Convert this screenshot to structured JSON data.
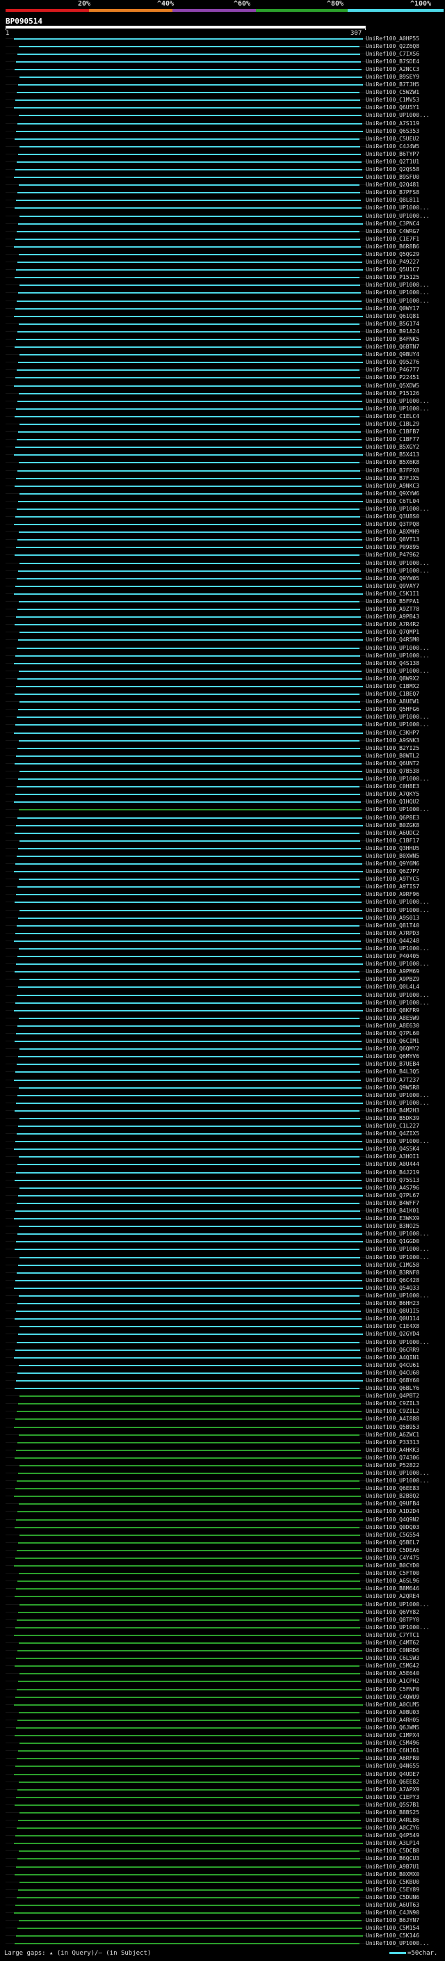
{
  "legend": {
    "percent_labels": [
      "20%",
      "^40%",
      "^60%",
      "^80%",
      "^100%"
    ],
    "colors": [
      "#d7191c",
      "#e67e22",
      "#8e44ad",
      "#2ca02c",
      "#4dd9e8"
    ]
  },
  "query": {
    "id": "BP090514",
    "start": "1",
    "end": "307"
  },
  "footer": {
    "text": "Large gaps: ▴ (in Query)/– (in Subject)",
    "scale_text": "=50char."
  },
  "hits": [
    {
      "id": "UniRef100_A0HP55",
      "c": "cyan"
    },
    {
      "id": "UniRef100_Q2Z6Q8",
      "c": "cyan"
    },
    {
      "id": "UniRef100_C7IXS6",
      "c": "cyan"
    },
    {
      "id": "UniRef100_B7SDE4",
      "c": "cyan"
    },
    {
      "id": "UniRef100_A2NCC3",
      "c": "cyan"
    },
    {
      "id": "UniRef100_B9SEY9",
      "c": "cyan"
    },
    {
      "id": "UniRef100_B7TJH5",
      "c": "cyan"
    },
    {
      "id": "UniRef100_C5WZW1",
      "c": "cyan"
    },
    {
      "id": "UniRef100_C1MV53",
      "c": "cyan"
    },
    {
      "id": "UniRef100_Q6U5Y1",
      "c": "cyan"
    },
    {
      "id": "UniRef100_UP1000...",
      "c": "cyan"
    },
    {
      "id": "UniRef100_A7S119",
      "c": "cyan"
    },
    {
      "id": "UniRef100_Q6S353",
      "c": "cyan"
    },
    {
      "id": "UniRef100_C5UEU2",
      "c": "cyan"
    },
    {
      "id": "UniRef100_C4J4W5",
      "c": "cyan"
    },
    {
      "id": "UniRef100_B6TYP7",
      "c": "cyan"
    },
    {
      "id": "UniRef100_Q2T1U1",
      "c": "cyan"
    },
    {
      "id": "UniRef100_Q2QS58",
      "c": "cyan"
    },
    {
      "id": "UniRef100_B9SFU0",
      "c": "cyan"
    },
    {
      "id": "UniRef100_Q2Q481",
      "c": "cyan"
    },
    {
      "id": "UniRef100_B7PFS8",
      "c": "cyan"
    },
    {
      "id": "UniRef100_Q8L811",
      "c": "cyan"
    },
    {
      "id": "UniRef100_UP1000...",
      "c": "cyan"
    },
    {
      "id": "UniRef100_UP1000...",
      "c": "cyan"
    },
    {
      "id": "UniRef100_C3PNC4",
      "c": "cyan"
    },
    {
      "id": "UniRef100_C4WRG7",
      "c": "cyan"
    },
    {
      "id": "UniRef100_C1E7F1",
      "c": "cyan"
    },
    {
      "id": "UniRef100_B6R8B6",
      "c": "cyan"
    },
    {
      "id": "UniRef100_Q5QG29",
      "c": "cyan"
    },
    {
      "id": "UniRef100_P49227",
      "c": "cyan"
    },
    {
      "id": "UniRef100_Q5U1C7",
      "c": "cyan"
    },
    {
      "id": "UniRef100_P15125",
      "c": "cyan"
    },
    {
      "id": "UniRef100_UP1000...",
      "c": "cyan"
    },
    {
      "id": "UniRef100_UP1000...",
      "c": "cyan"
    },
    {
      "id": "UniRef100_UP1000...",
      "c": "cyan"
    },
    {
      "id": "UniRef100_Q0WY17",
      "c": "cyan"
    },
    {
      "id": "UniRef100_Q61Q81",
      "c": "cyan"
    },
    {
      "id": "UniRef100_B5G174",
      "c": "cyan"
    },
    {
      "id": "UniRef100_B91A24",
      "c": "cyan"
    },
    {
      "id": "UniRef100_B4FNK5",
      "c": "cyan"
    },
    {
      "id": "UniRef100_Q6BTN7",
      "c": "cyan"
    },
    {
      "id": "UniRef100_Q9BUY4",
      "c": "cyan"
    },
    {
      "id": "UniRef100_Q95276",
      "c": "cyan"
    },
    {
      "id": "UniRef100_P46777",
      "c": "cyan"
    },
    {
      "id": "UniRef100_P22451",
      "c": "cyan"
    },
    {
      "id": "UniRef100_Q5XDW5",
      "c": "cyan"
    },
    {
      "id": "UniRef100_P15126",
      "c": "cyan"
    },
    {
      "id": "UniRef100_UP1000...",
      "c": "cyan"
    },
    {
      "id": "UniRef100_UP1000...",
      "c": "cyan"
    },
    {
      "id": "UniRef100_C1ELC4",
      "c": "cyan"
    },
    {
      "id": "UniRef100_C1BL29",
      "c": "cyan"
    },
    {
      "id": "UniRef100_C1BFB7",
      "c": "cyan"
    },
    {
      "id": "UniRef100_C1BF77",
      "c": "cyan"
    },
    {
      "id": "UniRef100_B5XGY2",
      "c": "cyan"
    },
    {
      "id": "UniRef100_B5X413",
      "c": "cyan"
    },
    {
      "id": "UniRef100_B5X6K8",
      "c": "cyan"
    },
    {
      "id": "UniRef100_B7FPX8",
      "c": "cyan"
    },
    {
      "id": "UniRef100_B7FJX5",
      "c": "cyan"
    },
    {
      "id": "UniRef100_A9NKC3",
      "c": "cyan"
    },
    {
      "id": "UniRef100_Q9XYW6",
      "c": "cyan"
    },
    {
      "id": "UniRef100_C6TL04",
      "c": "cyan"
    },
    {
      "id": "UniRef100_UP1000...",
      "c": "cyan"
    },
    {
      "id": "UniRef100_Q3U8S0",
      "c": "cyan"
    },
    {
      "id": "UniRef100_Q3TPQ8",
      "c": "cyan"
    },
    {
      "id": "UniRef100_A8XMH9",
      "c": "cyan"
    },
    {
      "id": "UniRef100_Q8VT13",
      "c": "cyan"
    },
    {
      "id": "UniRef100_P09895",
      "c": "cyan"
    },
    {
      "id": "UniRef100_P47962",
      "c": "cyan"
    },
    {
      "id": "UniRef100_UP1000...",
      "c": "cyan"
    },
    {
      "id": "UniRef100_UP1000...",
      "c": "cyan"
    },
    {
      "id": "UniRef100_Q9YW05",
      "c": "cyan"
    },
    {
      "id": "UniRef100_Q9VAY7",
      "c": "cyan"
    },
    {
      "id": "UniRef100_C5K1I1",
      "c": "cyan"
    },
    {
      "id": "UniRef100_B5FPA1",
      "c": "cyan"
    },
    {
      "id": "UniRef100_A9ZT78",
      "c": "cyan"
    },
    {
      "id": "UniRef100_A9PB43",
      "c": "cyan"
    },
    {
      "id": "UniRef100_A7R4R2",
      "c": "cyan"
    },
    {
      "id": "UniRef100_Q7QMP1",
      "c": "cyan"
    },
    {
      "id": "UniRef100_Q4R5M0",
      "c": "cyan"
    },
    {
      "id": "UniRef100_UP1000...",
      "c": "cyan"
    },
    {
      "id": "UniRef100_UP1000...",
      "c": "cyan"
    },
    {
      "id": "UniRef100_Q4S138",
      "c": "cyan"
    },
    {
      "id": "UniRef100_UP1000...",
      "c": "cyan"
    },
    {
      "id": "UniRef100_Q8W9X2",
      "c": "cyan"
    },
    {
      "id": "UniRef100_C1BMX2",
      "c": "cyan"
    },
    {
      "id": "UniRef100_C1BEQ7",
      "c": "cyan"
    },
    {
      "id": "UniRef100_A8UEW1",
      "c": "cyan"
    },
    {
      "id": "UniRef100_Q5HFG6",
      "c": "cyan"
    },
    {
      "id": "UniRef100_UP1000...",
      "c": "cyan"
    },
    {
      "id": "UniRef100_UP1000...",
      "c": "cyan"
    },
    {
      "id": "UniRef100_C3KHP7",
      "c": "cyan"
    },
    {
      "id": "UniRef100_A9SNK3",
      "c": "cyan"
    },
    {
      "id": "UniRef100_B2YI25",
      "c": "cyan"
    },
    {
      "id": "UniRef100_B0WTL2",
      "c": "cyan"
    },
    {
      "id": "UniRef100_Q6UNT2",
      "c": "cyan"
    },
    {
      "id": "UniRef100_Q7B538",
      "c": "cyan"
    },
    {
      "id": "UniRef100_UP1000...",
      "c": "cyan"
    },
    {
      "id": "UniRef100_C0H8E3",
      "c": "cyan"
    },
    {
      "id": "UniRef100_A7QKY5",
      "c": "cyan"
    },
    {
      "id": "UniRef100_Q1HQU2",
      "c": "cyan"
    },
    {
      "id": "UniRef100_UP1000...",
      "c": "green"
    },
    {
      "id": "UniRef100_Q6P8E3",
      "c": "cyan"
    },
    {
      "id": "UniRef100_B0ZGK8",
      "c": "cyan"
    },
    {
      "id": "UniRef100_A6UDC2",
      "c": "cyan"
    },
    {
      "id": "UniRef100_C1BF17",
      "c": "cyan"
    },
    {
      "id": "UniRef100_Q3HHU5",
      "c": "cyan"
    },
    {
      "id": "UniRef100_B0XWN5",
      "c": "cyan"
    },
    {
      "id": "UniRef100_Q9Y6M6",
      "c": "cyan"
    },
    {
      "id": "UniRef100_Q6Z7P7",
      "c": "cyan"
    },
    {
      "id": "UniRef100_A9TYC5",
      "c": "cyan"
    },
    {
      "id": "UniRef100_A9TIS7",
      "c": "cyan"
    },
    {
      "id": "UniRef100_A9RF96",
      "c": "cyan"
    },
    {
      "id": "UniRef100_UP1000...",
      "c": "cyan"
    },
    {
      "id": "UniRef100_UP1000...",
      "c": "cyan"
    },
    {
      "id": "UniRef100_A9S013",
      "c": "cyan"
    },
    {
      "id": "UniRef100_Q81T40",
      "c": "cyan"
    },
    {
      "id": "UniRef100_A7RPD3",
      "c": "cyan"
    },
    {
      "id": "UniRef100_Q44248",
      "c": "cyan"
    },
    {
      "id": "UniRef100_UP1000...",
      "c": "cyan"
    },
    {
      "id": "UniRef100_P40405",
      "c": "cyan"
    },
    {
      "id": "UniRef100_UP1000...",
      "c": "cyan"
    },
    {
      "id": "UniRef100_A9PM69",
      "c": "cyan"
    },
    {
      "id": "UniRef100_A9PBZ9",
      "c": "cyan"
    },
    {
      "id": "UniRef100_Q0L4L4",
      "c": "cyan"
    },
    {
      "id": "UniRef100_UP1000...",
      "c": "cyan"
    },
    {
      "id": "UniRef100_UP1000...",
      "c": "cyan"
    },
    {
      "id": "UniRef100_Q8KFR9",
      "c": "cyan"
    },
    {
      "id": "UniRef100_A8E5W9",
      "c": "cyan"
    },
    {
      "id": "UniRef100_A8E630",
      "c": "cyan"
    },
    {
      "id": "UniRef100_Q7PL60",
      "c": "cyan"
    },
    {
      "id": "UniRef100_Q6CIM1",
      "c": "cyan"
    },
    {
      "id": "UniRef100_Q6QMY2",
      "c": "cyan"
    },
    {
      "id": "UniRef100_Q6MYV6",
      "c": "cyan"
    },
    {
      "id": "UniRef100_B7UEB4",
      "c": "cyan"
    },
    {
      "id": "UniRef100_B4L3Q5",
      "c": "cyan"
    },
    {
      "id": "UniRef100_A7T237",
      "c": "cyan"
    },
    {
      "id": "UniRef100_Q9W5R8",
      "c": "cyan"
    },
    {
      "id": "UniRef100_UP1000...",
      "c": "cyan"
    },
    {
      "id": "UniRef100_UP1000...",
      "c": "cyan"
    },
    {
      "id": "UniRef100_B4M2H3",
      "c": "cyan"
    },
    {
      "id": "UniRef100_B5DK39",
      "c": "cyan"
    },
    {
      "id": "UniRef100_C1L227",
      "c": "cyan"
    },
    {
      "id": "UniRef100_Q4ZIX5",
      "c": "cyan"
    },
    {
      "id": "UniRef100_UP1000...",
      "c": "cyan"
    },
    {
      "id": "UniRef100_Q4S5K4",
      "c": "cyan"
    },
    {
      "id": "UniRef100_A3HOI1",
      "c": "cyan"
    },
    {
      "id": "UniRef100_A0U444",
      "c": "cyan"
    },
    {
      "id": "UniRef100_B4J219",
      "c": "cyan"
    },
    {
      "id": "UniRef100_Q75S13",
      "c": "cyan"
    },
    {
      "id": "UniRef100_A4S796",
      "c": "cyan"
    },
    {
      "id": "UniRef100_Q7PL67",
      "c": "cyan"
    },
    {
      "id": "UniRef100_B4WFF7",
      "c": "cyan"
    },
    {
      "id": "UniRef100_B41K01",
      "c": "cyan"
    },
    {
      "id": "UniRef100_E3WKX9",
      "c": "cyan"
    },
    {
      "id": "UniRef100_B3NO25",
      "c": "cyan"
    },
    {
      "id": "UniRef100_UP1000...",
      "c": "cyan"
    },
    {
      "id": "UniRef100_Q1GGD0",
      "c": "cyan"
    },
    {
      "id": "UniRef100_UP1000...",
      "c": "cyan"
    },
    {
      "id": "UniRef100_UP1000...",
      "c": "cyan"
    },
    {
      "id": "UniRef100_C1MG58",
      "c": "cyan"
    },
    {
      "id": "UniRef100_B3RNF8",
      "c": "cyan"
    },
    {
      "id": "UniRef100_Q6C428",
      "c": "cyan"
    },
    {
      "id": "UniRef100_Q54Q33",
      "c": "cyan"
    },
    {
      "id": "UniRef100_UP1000...",
      "c": "cyan"
    },
    {
      "id": "UniRef100_B6HH23",
      "c": "cyan"
    },
    {
      "id": "UniRef100_Q8U1I5",
      "c": "cyan"
    },
    {
      "id": "UniRef100_Q0U114",
      "c": "cyan"
    },
    {
      "id": "UniRef100_C1E4X8",
      "c": "cyan"
    },
    {
      "id": "UniRef100_Q2GYD4",
      "c": "cyan"
    },
    {
      "id": "UniRef100_UP1000...",
      "c": "cyan"
    },
    {
      "id": "UniRef100_Q6CRR9",
      "c": "cyan"
    },
    {
      "id": "UniRef100_A4QIN1",
      "c": "cyan"
    },
    {
      "id": "UniRef100_Q4CU61",
      "c": "cyan"
    },
    {
      "id": "UniRef100_Q4CU60",
      "c": "cyan"
    },
    {
      "id": "UniRef100_Q6BY60",
      "c": "cyan"
    },
    {
      "id": "UniRef100_Q6BLY6",
      "c": "cyan"
    },
    {
      "id": "UniRef100_Q4PBT2",
      "c": "green"
    },
    {
      "id": "UniRef100_C9ZIL3",
      "c": "green"
    },
    {
      "id": "UniRef100_C9ZIL2",
      "c": "green"
    },
    {
      "id": "UniRef100_A4I888",
      "c": "green"
    },
    {
      "id": "UniRef100_Q5B953",
      "c": "green"
    },
    {
      "id": "UniRef100_A6ZWC1",
      "c": "green"
    },
    {
      "id": "UniRef100_P33313",
      "c": "green"
    },
    {
      "id": "UniRef100_A4HKK3",
      "c": "green"
    },
    {
      "id": "UniRef100_Q74306",
      "c": "green"
    },
    {
      "id": "UniRef100_P52822",
      "c": "green"
    },
    {
      "id": "UniRef100_UP1000...",
      "c": "green"
    },
    {
      "id": "UniRef100_UP1000...",
      "c": "green"
    },
    {
      "id": "UniRef100_Q6EE83",
      "c": "green"
    },
    {
      "id": "UniRef100_B2B8Q2",
      "c": "green"
    },
    {
      "id": "UniRef100_Q9UFB4",
      "c": "green"
    },
    {
      "id": "UniRef100_A1D2D4",
      "c": "green"
    },
    {
      "id": "UniRef100_Q4Q9N2",
      "c": "green"
    },
    {
      "id": "UniRef100_Q0DQ03",
      "c": "green"
    },
    {
      "id": "UniRef100_C5G554",
      "c": "green"
    },
    {
      "id": "UniRef100_Q5BEL7",
      "c": "green"
    },
    {
      "id": "UniRef100_C5DEA6",
      "c": "green"
    },
    {
      "id": "UniRef100_C4Y475",
      "c": "green"
    },
    {
      "id": "UniRef100_B0CYD0",
      "c": "green"
    },
    {
      "id": "UniRef100_C5FT00",
      "c": "green"
    },
    {
      "id": "UniRef100_A6SL96",
      "c": "green"
    },
    {
      "id": "UniRef100_B8M646",
      "c": "green"
    },
    {
      "id": "UniRef100_A2QRE4",
      "c": "green"
    },
    {
      "id": "UniRef100_UP1000...",
      "c": "green"
    },
    {
      "id": "UniRef100_Q6VY82",
      "c": "green"
    },
    {
      "id": "UniRef100_Q8TPY0",
      "c": "green"
    },
    {
      "id": "UniRef100_UP1000...",
      "c": "green"
    },
    {
      "id": "UniRef100_C7YTC1",
      "c": "green"
    },
    {
      "id": "UniRef100_C4MT62",
      "c": "green"
    },
    {
      "id": "UniRef100_C0NRD6",
      "c": "green"
    },
    {
      "id": "UniRef100_C6LSW3",
      "c": "green"
    },
    {
      "id": "UniRef100_C5MG42",
      "c": "green"
    },
    {
      "id": "UniRef100_A5E640",
      "c": "green"
    },
    {
      "id": "UniRef100_A1CPH2",
      "c": "green"
    },
    {
      "id": "UniRef100_C5FNF0",
      "c": "green"
    },
    {
      "id": "UniRef100_C4QWU9",
      "c": "green"
    },
    {
      "id": "UniRef100_A0CLM5",
      "c": "green"
    },
    {
      "id": "UniRef100_A0BU03",
      "c": "green"
    },
    {
      "id": "UniRef100_A4RH05",
      "c": "green"
    },
    {
      "id": "UniRef100_Q6JWM5",
      "c": "green"
    },
    {
      "id": "UniRef100_C1MPX4",
      "c": "green"
    },
    {
      "id": "UniRef100_C5M496",
      "c": "green"
    },
    {
      "id": "UniRef100_C6HJ61",
      "c": "green"
    },
    {
      "id": "UniRef100_A6RFR0",
      "c": "green"
    },
    {
      "id": "UniRef100_Q4N655",
      "c": "green"
    },
    {
      "id": "UniRef100_Q4UDE7",
      "c": "green"
    },
    {
      "id": "UniRef100_Q6EE82",
      "c": "green"
    },
    {
      "id": "UniRef100_A7APX9",
      "c": "green"
    },
    {
      "id": "UniRef100_C1EPY3",
      "c": "green"
    },
    {
      "id": "UniRef100_Q5S7B1",
      "c": "green"
    },
    {
      "id": "UniRef100_B8BS25",
      "c": "green"
    },
    {
      "id": "UniRef100_A4RL86",
      "c": "green"
    },
    {
      "id": "UniRef100_A0CZY6",
      "c": "green"
    },
    {
      "id": "UniRef100_Q4P549",
      "c": "green"
    },
    {
      "id": "UniRef100_A3LP14",
      "c": "green"
    },
    {
      "id": "UniRef100_C5DCB8",
      "c": "green"
    },
    {
      "id": "UniRef100_B6QCU3",
      "c": "green"
    },
    {
      "id": "UniRef100_A9B7U1",
      "c": "green"
    },
    {
      "id": "UniRef100_B0XMX0",
      "c": "green"
    },
    {
      "id": "UniRef100_C5KBU0",
      "c": "green"
    },
    {
      "id": "UniRef100_C5EY89",
      "c": "green"
    },
    {
      "id": "UniRef100_C5DUN6",
      "c": "green"
    },
    {
      "id": "UniRef100_A6UT63",
      "c": "green"
    },
    {
      "id": "UniRef100_C4JN90",
      "c": "green"
    },
    {
      "id": "UniRef100_B6JYN7",
      "c": "green"
    },
    {
      "id": "UniRef100_C5M154",
      "c": "green"
    },
    {
      "id": "UniRef100_C5K146",
      "c": "green"
    },
    {
      "id": "UniRef100_UP1000...",
      "c": "green"
    }
  ]
}
